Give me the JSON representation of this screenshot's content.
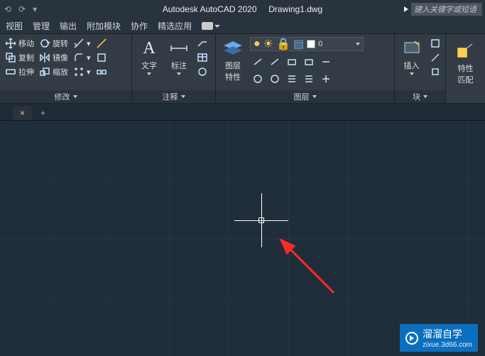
{
  "title": {
    "app": "Autodesk AutoCAD 2020",
    "file": "Drawing1.dwg"
  },
  "titlebar": {
    "search_placeholder": "键入关键字或短语"
  },
  "menubar": {
    "items": [
      "视图",
      "管理",
      "输出",
      "附加模块",
      "协作",
      "精选应用"
    ]
  },
  "ribbon": {
    "modify": {
      "title": "修改",
      "r1": {
        "move": "移动",
        "rotate": "旋转"
      },
      "r2": {
        "copy": "复制",
        "mirror": "镜像"
      },
      "r3": {
        "stretch": "拉伸",
        "scale": "缩放"
      }
    },
    "annotate": {
      "title": "注释",
      "text": "文字",
      "dim": "标注"
    },
    "layers": {
      "title": "图层",
      "props": "图层\n特性",
      "current": "0"
    },
    "block": {
      "title": "块",
      "insert": "插入"
    },
    "properties": {
      "title": "特性\n匹配",
      "btn": "特性\n匹配"
    }
  },
  "tabs": {
    "close": "×",
    "plus": "+"
  },
  "watermark": {
    "name": "溜溜自学",
    "url": "zixue.3d66.com"
  }
}
